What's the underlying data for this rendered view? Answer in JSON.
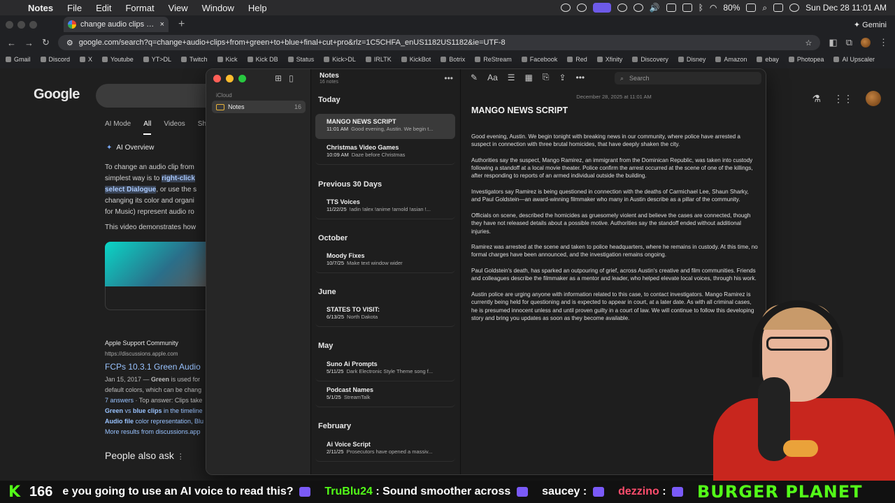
{
  "menubar": {
    "apple": "",
    "app_name": "Notes",
    "items": [
      "File",
      "Edit",
      "Format",
      "View",
      "Window",
      "Help"
    ],
    "battery": "80%",
    "clock": "Sun Dec 28  11:01 AM"
  },
  "browser": {
    "tab_title": "change audio clips from gree",
    "tab_close": "×",
    "new_tab": "+",
    "gemini_label": "Gemini",
    "url": "google.com/search?q=change+audio+clips+from+green+to+blue+final+cut+pro&rlz=1C5CHFA_enUS1182US1182&ie=UTF-8",
    "bookmarks": [
      "Gmail",
      "Discord",
      "X",
      "Youtube",
      "YT>DL",
      "Twitch",
      "Kick",
      "Kick DB",
      "Status",
      "Kick>DL",
      "IRLTK",
      "KickBot",
      "Botrix",
      "ReStream",
      "Facebook",
      "Red",
      "Xfinity",
      "Discovery",
      "Disney",
      "Amazon",
      "ebay",
      "Photopea",
      "AI Upscaler"
    ]
  },
  "google": {
    "logo": "Google",
    "tabs": [
      "AI Mode",
      "All",
      "Videos",
      "Sho"
    ],
    "active_tab": "All",
    "ai_overview": "AI Overview",
    "snippet": {
      "l1": "To change an audio clip from",
      "l2a": "simplest way is to ",
      "l2b": "right-click",
      "l3a": "select Dialogue",
      "l3b": ", or use the s",
      "l4": "changing its color and organi",
      "l5": "for Music) represent audio ro"
    },
    "video_caption": "This video demonstrates how",
    "result": {
      "site": "Apple Support Community",
      "url": "https://discussions.apple.com",
      "title": "FCPs 10.3.1 Green Audio",
      "date_line_a": "Jan 15, 2017 — ",
      "date_line_b": "Green",
      "date_line_c": " is used for",
      "line2": "default colors, which can be chang",
      "line3a": "7 answers",
      "line3b": " · Top answer: Clips take",
      "line4a": "Green",
      "line4b": " vs ",
      "line4c": "blue clips",
      "line4d": " in the timeline",
      "line5a": "Audio file",
      "line5b": " color representation, Blu",
      "more": "More results from discussions.app"
    },
    "people_also_ask": "People also ask"
  },
  "notes": {
    "sidebar": {
      "account": "iCloud",
      "folder": "Notes",
      "folder_count": "16"
    },
    "list": {
      "title": "Notes",
      "count": "16 notes",
      "sections": {
        "today": "Today",
        "prev30": "Previous 30 Days",
        "october": "October",
        "june": "June",
        "may": "May",
        "february": "February"
      },
      "items": [
        {
          "title": "MANGO NEWS SCRIPT",
          "date": "11:01 AM",
          "preview": "Good evening, Austin. We begin t..."
        },
        {
          "title": "Christmas Video Games",
          "date": "10:09 AM",
          "preview": "Daze before Christmas"
        },
        {
          "title": "TTS Voices",
          "date": "11/22/25",
          "preview": "!adin !alex !anime !arnold !asian !..."
        },
        {
          "title": "Moody Fixes",
          "date": "10/7/25",
          "preview": "Make text window wider"
        },
        {
          "title": "STATES TO VISIT:",
          "date": "6/13/25",
          "preview": "North Dakota"
        },
        {
          "title": "Suno Ai Prompts",
          "date": "5/11/25",
          "preview": "Dark Electronic Style Theme song f..."
        },
        {
          "title": "Podcast Names",
          "date": "5/1/25",
          "preview": "StreamTalk"
        },
        {
          "title": "Ai Voice Script",
          "date": "2/11/25",
          "preview": "Prosecutors have opened a massiv..."
        }
      ]
    },
    "editor": {
      "search_placeholder": "Search",
      "date": "December 28, 2025 at 11:01 AM",
      "title": "MANGO NEWS SCRIPT",
      "paragraphs": [
        "Good evening, Austin. We begin tonight with breaking news in our community, where police have arrested a suspect in connection with three brutal homicides, that have deeply shaken the city.",
        "Authorities say the suspect, Mango Ramirez, an immigrant from the Dominican Republic, was taken into custody following a standoff at a local movie theater. Police confirm the arrest occurred at the scene of one of the killings, after responding to reports of an armed individual outside the building.",
        "Investigators say Ramirez is being questioned in connection with the deaths of Carmichael Lee, Shaun Sharky, and Paul Goldstein—an award-winning filmmaker who many in Austin describe as a pillar of the community.",
        "Officials on scene, described the homicides as gruesomely violent and believe the cases are connected, though they have not released details about a possible motive. Authorities say the standoff ended without additional injuries.",
        "Ramirez was arrested at the scene and taken to police headquarters, where he remains in custody. At this time, no formal charges have been announced, and the investigation remains ongoing.",
        "Paul Goldstein's death, has sparked an outpouring of grief, across Austin's creative and film communities. Friends and colleagues describe the filmmaker as a mentor and leader, who helped elevate local voices, through his work.",
        "Austin police are urging anyone with information related to this case, to contact investigators. Mango Ramirez is currently being held for questioning and is expected to appear in court, at a later date. As with all criminal cases, he is presumed innocent unless and until proven guilty in a court of law. We will continue to follow this developing story and bring you updates as soon as they become available."
      ]
    }
  },
  "ticker": {
    "logo": "K",
    "viewers": "166",
    "msg1": "e you going to use an AI voice to read this?",
    "user1": "TruBlu24",
    "msg2": ": Sound smoother across",
    "user2": "saucey",
    "sep2": ":",
    "user3": "dezzino",
    "sep3": ":",
    "sponsor": "BURGER PLANET"
  },
  "colors": {
    "kick_green": "#53fc18",
    "notes_folder": "#e8b23a",
    "light_red": "#ff5f57",
    "light_yellow": "#febc2e",
    "light_green": "#28c840"
  }
}
